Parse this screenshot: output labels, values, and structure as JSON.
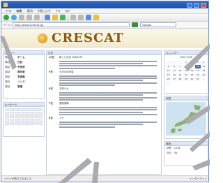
{
  "browser": {
    "menu": [
      "ﾌｧｲﾙ",
      "編集",
      "表示",
      "ｵ気に入り",
      "ﾂｰﾙ",
      "ﾍﾙﾌﾟ"
    ],
    "address_label": "ｱﾄﾞﾚｽ",
    "address_value": "http://www.crescat.jp/",
    "search_placeholder": "Google"
  },
  "site": {
    "logo": "CRESCAT"
  },
  "left_panel": {
    "header": "メニュー",
    "rows": [
      {
        "k": "項目",
        "v": "ホーム"
      },
      {
        "k": "項目",
        "v": "日記"
      },
      {
        "k": "項目",
        "v": "予定表"
      },
      {
        "k": "項目",
        "v": "掲示板"
      },
      {
        "k": "項目",
        "v": "写真集"
      },
      {
        "k": "項目",
        "v": "リンク"
      },
      {
        "k": "項目",
        "v": "管理"
      }
    ]
  },
  "left_panel2": {
    "header": "キーボード"
  },
  "center_panel": {
    "header": "日記",
    "entries": [
      {
        "date": "10日",
        "text": "新しい日記 CRESCAT"
      },
      {
        "date": "9日",
        "text": "今日の出来事"
      },
      {
        "date": "8日",
        "text": "お知らせ"
      },
      {
        "date": "7日",
        "text": "更新情報"
      },
      {
        "date": "6日",
        "text": "メモ"
      }
    ]
  },
  "right_panel": {
    "header": "カレンダー",
    "month": "10月 2008",
    "days": [
      "",
      "",
      "",
      "1",
      "2",
      "3",
      "4",
      "5",
      "6",
      "7",
      "8",
      "9",
      "10",
      "11",
      "12",
      "13",
      "14",
      "15",
      "16",
      "17",
      "18",
      "19",
      "20",
      "21",
      "22",
      "23",
      "24",
      "25",
      "26",
      "27",
      "28",
      "29",
      "30",
      "31",
      "",
      ""
    ],
    "highlight_index": 12
  },
  "right_panel2": {
    "header": "地図"
  },
  "right_panel3": {
    "header": "情報",
    "rows": [
      {
        "a": "訪問",
        "b": "1234"
      },
      {
        "a": "今日",
        "b": "56"
      }
    ]
  },
  "status": {
    "left": "ページが表示されました",
    "right": "インターネット"
  },
  "colors": {
    "accent": "#2f68c9",
    "logo": "#8a5a10",
    "callout": "#a9abae"
  }
}
